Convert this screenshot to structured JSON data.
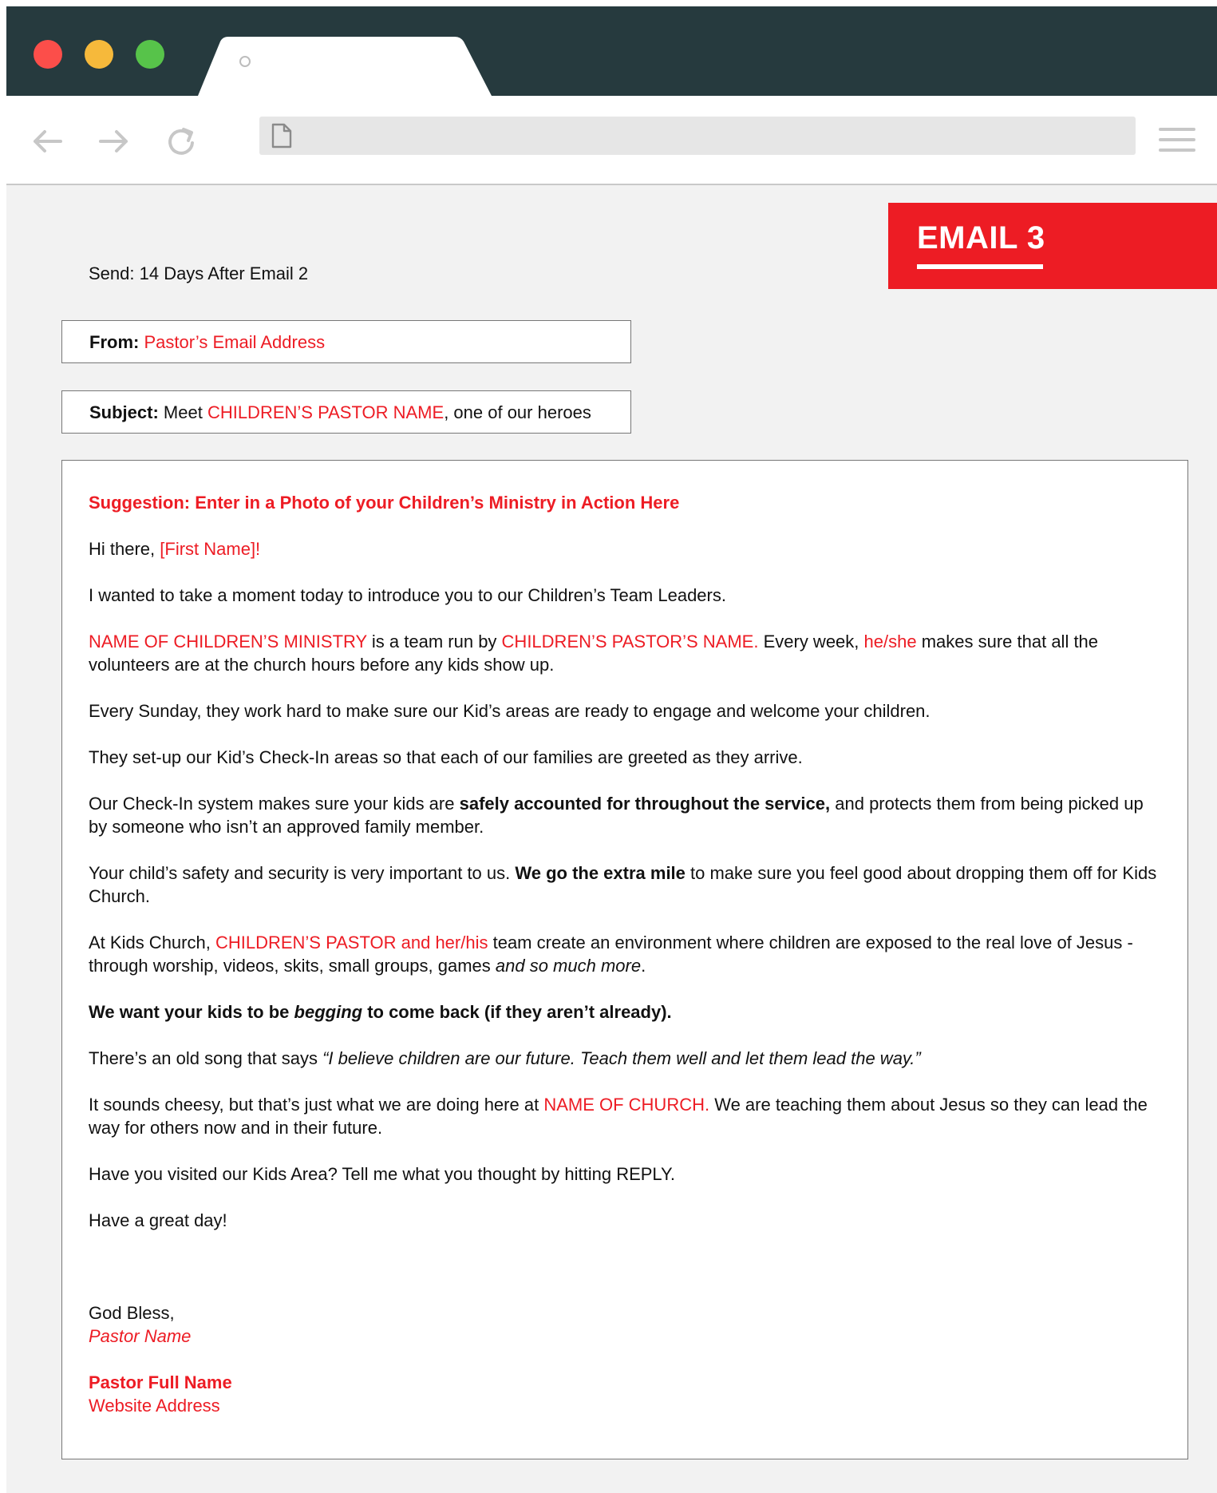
{
  "browser": {
    "icons": {
      "back": "arrow-left-icon",
      "forward": "arrow-right-icon",
      "reload": "reload-icon",
      "page": "page-icon",
      "menu": "hamburger-menu-icon"
    },
    "colors": {
      "titlebar": "#263a3e",
      "close": "#fc4e4a",
      "minimize": "#f6b93b",
      "maximize": "#57c34a"
    }
  },
  "badge": {
    "label": "EMAIL 3",
    "color": "#ed1c24"
  },
  "send": "Send: 14 Days After Email 2",
  "from": {
    "label": "From:",
    "value": "Pastor’s Email Address"
  },
  "subject": {
    "label": "Subject:",
    "pre": " Meet ",
    "highlight": "CHILDREN’S PASTOR NAME",
    "post": ", one of our heroes"
  },
  "email": {
    "suggestion": "Suggestion: Enter in a Photo of your Children’s Ministry in Action Here",
    "greeting": {
      "pre": "Hi there, ",
      "name": "[First Name]!"
    },
    "p1": "I wanted to take a moment today to introduce you to our Children’s Team Leaders.",
    "p2": {
      "ministry": "NAME OF CHILDREN’S MINISTRY",
      "a": " is a team run by ",
      "pastor": "CHILDREN’S PASTOR’S NAME.",
      "b": " Every week, ",
      "pronoun": "he/she",
      "c": " makes sure that all the volunteers are at the church hours before any kids show up."
    },
    "p3": "Every Sunday, they work hard to make sure our Kid’s areas are ready to engage and welcome your children.",
    "p4": "They set-up our Kid’s Check-In areas so that each of our families are greeted as they arrive.",
    "p5": {
      "a": "Our Check-In system makes sure your kids are ",
      "bold": "safely accounted for throughout the service,",
      "b": " and protects them from being picked up by someone who isn’t an approved family member."
    },
    "p6": {
      "a": "Your child’s safety and security is very important to us. ",
      "bold": "We go the extra mile",
      "b": " to make sure you feel good about dropping them off for Kids Church."
    },
    "p7": {
      "a": "At Kids Church, ",
      "pastor": "CHILDREN’S PASTOR and her/his",
      "b": " team create an environment where children are exposed to the real love of Jesus - through worship, videos, skits, small groups, games ",
      "italic": "and so much more",
      "c": "."
    },
    "p8": {
      "a": "We want your kids to be ",
      "italic": "begging",
      "b": " to come back (if they aren’t already)."
    },
    "p9": {
      "a": "There’s an old song that says ",
      "quote": "“I believe children are our future. Teach them well and let them lead the way.”"
    },
    "p10": {
      "a": "It sounds cheesy, but that’s just what we are doing here at ",
      "church": "NAME OF CHURCH.",
      "b": " We are teaching them about Jesus so they can lead the way for others now and in their future."
    },
    "p11": "Have you visited our Kids Area? Tell me what you thought by hitting REPLY.",
    "p12": "Have a great day!",
    "closing": "God Bless,",
    "signature_name": "Pastor Name",
    "full_name": "Pastor Full Name",
    "website": "Website Address"
  }
}
